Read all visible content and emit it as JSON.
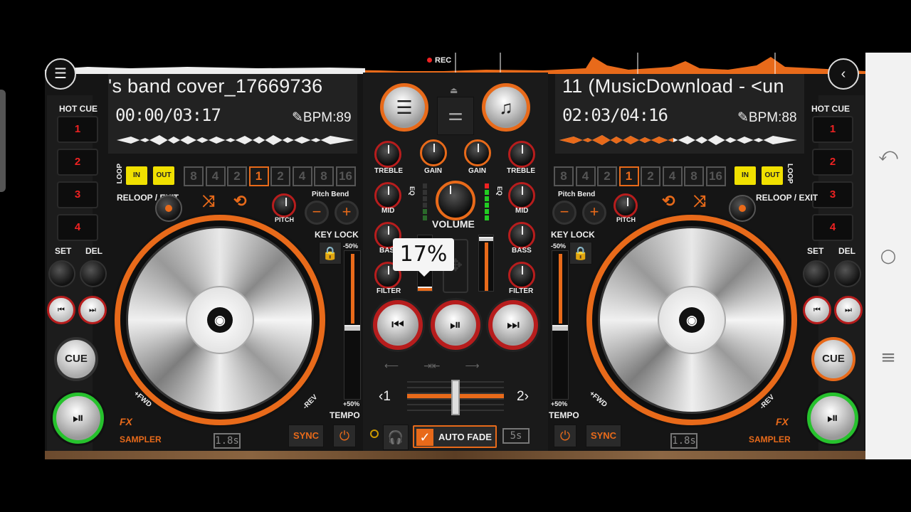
{
  "app": {
    "rec_label": "REC"
  },
  "deckA": {
    "title": "'s band cover_17669736",
    "time": "00:00/03:17",
    "bpm": "BPM:89",
    "hot_cue_label": "HOT CUE",
    "hot_cues": [
      "1",
      "2",
      "3",
      "4"
    ],
    "set_label": "SET",
    "del_label": "DEL",
    "cue_label": "CUE",
    "loop_label": "LOOP",
    "in_label": "IN",
    "out_label": "OUT",
    "beats": [
      "8",
      "4",
      "2",
      "1",
      "2",
      "4",
      "8",
      "16"
    ],
    "active_beat_index": 3,
    "reloop_label": "RELOOP / EXIT",
    "pitch_bend_label": "Pitch Bend",
    "pitch_label": "PITCH",
    "key_lock_label": "KEY LOCK",
    "tempo_minus": "-50%",
    "tempo_plus": "+50%",
    "tempo_label": "TEMPO",
    "fwd_label": "+FWD",
    "rev_label": "-REV",
    "fx_label": "FX",
    "sampler_label": "SAMPLER",
    "sync_label": "SYNC",
    "loop_time": "1.8s",
    "progress": 0.0
  },
  "deckB": {
    "title": "11 (MusicDownload - <un",
    "time": "02:03/04:16",
    "bpm": "BPM:88",
    "hot_cue_label": "HOT CUE",
    "hot_cues": [
      "1",
      "2",
      "3",
      "4"
    ],
    "set_label": "SET",
    "del_label": "DEL",
    "cue_label": "CUE",
    "loop_label": "LOOP",
    "in_label": "IN",
    "out_label": "OUT",
    "beats": [
      "8",
      "4",
      "2",
      "1",
      "2",
      "4",
      "8",
      "16"
    ],
    "active_beat_index": 3,
    "reloop_label": "RELOOP / EXIT",
    "pitch_bend_label": "Pitch Bend",
    "pitch_label": "PITCH",
    "key_lock_label": "KEY LOCK",
    "tempo_minus": "-50%",
    "tempo_plus": "+50%",
    "tempo_label": "TEMPO",
    "fwd_label": "+FWD",
    "rev_label": "-REV",
    "fx_label": "FX",
    "sampler_label": "SAMPLER",
    "sync_label": "SYNC",
    "loop_time": "1.8s",
    "progress": 0.48
  },
  "mixer": {
    "treble_label": "TREBLE",
    "gain_label": "GAIN",
    "mid_label": "MID",
    "bass_label": "BASS",
    "filter_label": "FILTER",
    "eq_label": "EQ",
    "volume_label": "VOLUME",
    "crossfader_left": "‹1",
    "crossfader_right": "2›",
    "popup_value": "17%",
    "auto_fade_label": "AUTO FADE",
    "auto_fade_checked": true,
    "fade_time": "5s"
  },
  "icons": {
    "menu": "menu-icon",
    "back": "chevron-left-icon",
    "playlist": "list-icon",
    "music": "music-note-icon",
    "eq_sliders": "sliders-icon",
    "prev": "skip-previous-icon",
    "playpause": "play-pause-icon",
    "next": "skip-next-icon",
    "headphones": "headphones-icon",
    "lock": "lock-icon",
    "shuffle": "shuffle-icon",
    "repeat": "repeat-icon"
  },
  "colors": {
    "accent": "#e86a1a",
    "red": "#b71d1d",
    "play_green": "#26c22d",
    "hotcue_text": "#e22222",
    "yellow": "#f0e000"
  },
  "system_nav": {
    "back": "back-icon",
    "home": "home-icon",
    "menu": "recents-icon"
  }
}
